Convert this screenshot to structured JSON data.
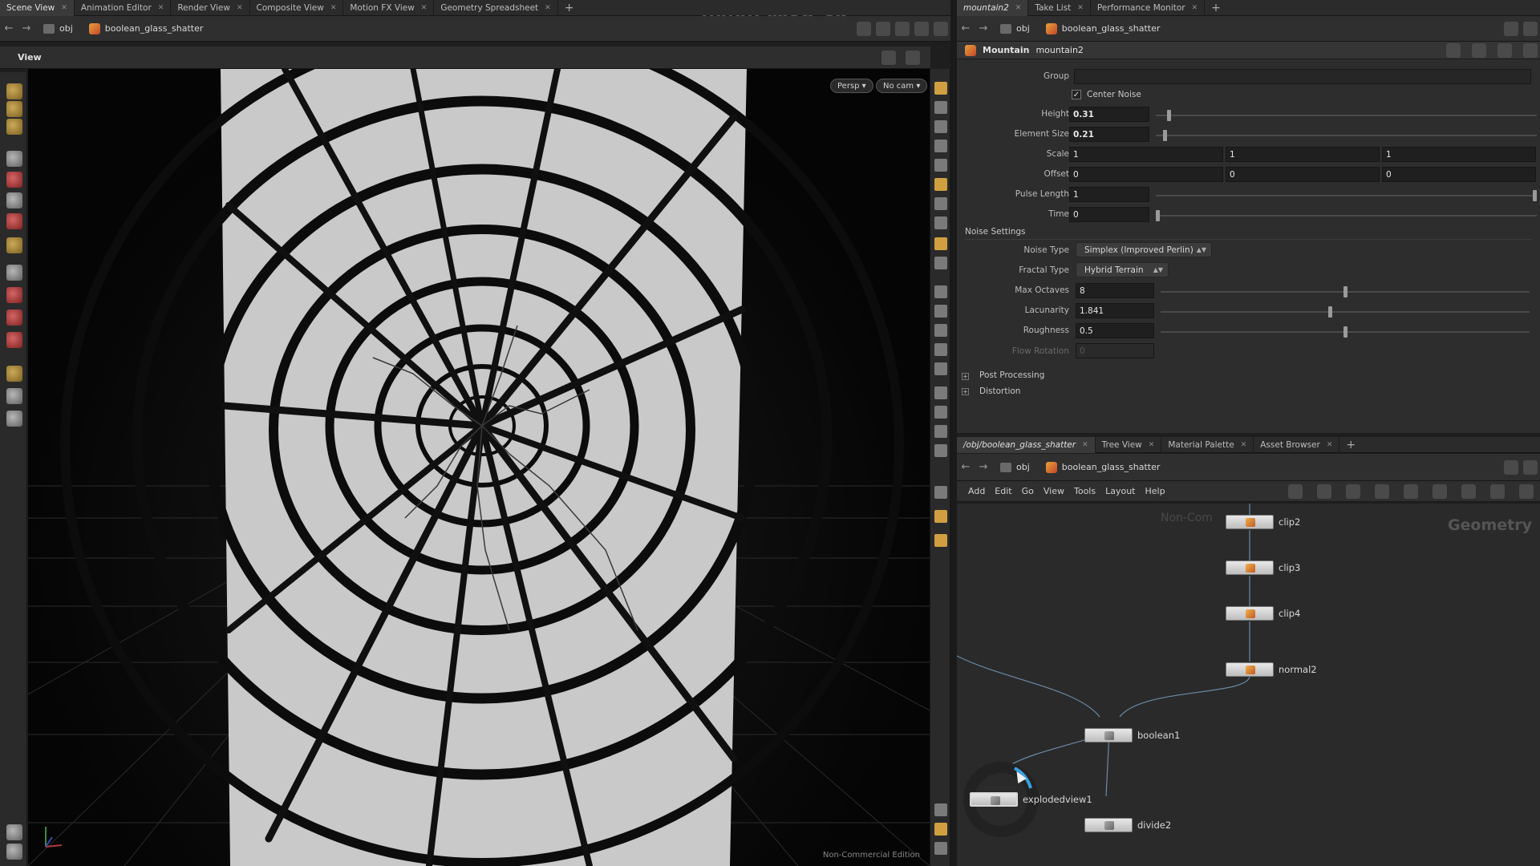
{
  "left_tabs": [
    {
      "label": "Scene View",
      "active": true
    },
    {
      "label": "Animation Editor"
    },
    {
      "label": "Render View"
    },
    {
      "label": "Composite View"
    },
    {
      "label": "Motion FX View"
    },
    {
      "label": "Geometry Spreadsheet"
    }
  ],
  "left_path": {
    "root": "obj",
    "node": "boolean_glass_shatter"
  },
  "viewport": {
    "title": "View",
    "persp_button": "Persp ▾",
    "cam_button": "No cam ▾",
    "edition_label": "Non-Commercial Edition"
  },
  "right_top_tabs": [
    {
      "label": "mountain2",
      "active": true
    },
    {
      "label": "Take List"
    },
    {
      "label": "Performance Monitor"
    }
  ],
  "right_top_path": {
    "root": "obj",
    "node": "boolean_glass_shatter"
  },
  "params": {
    "node_type": "Mountain",
    "node_name": "mountain2",
    "group_label": "Group",
    "center_noise_label": "Center Noise",
    "center_noise_checked": true,
    "height": {
      "label": "Height",
      "value": "0.31",
      "fraction": 0.03
    },
    "element_size": {
      "label": "Element Size",
      "value": "0.21",
      "fraction": 0.02
    },
    "scale": {
      "label": "Scale",
      "values": [
        "1",
        "1",
        "1"
      ]
    },
    "offset": {
      "label": "Offset",
      "values": [
        "0",
        "0",
        "0"
      ]
    },
    "pulse_length": {
      "label": "Pulse Length",
      "value": "1",
      "fraction": 1.0
    },
    "time": {
      "label": "Time",
      "value": "0",
      "fraction": 0.0
    },
    "noise_settings_label": "Noise Settings",
    "noise_type": {
      "label": "Noise Type",
      "value": "Simplex (Improved Perlin)"
    },
    "fractal_type": {
      "label": "Fractal Type",
      "value": "Hybrid Terrain"
    },
    "max_octaves": {
      "label": "Max Octaves",
      "value": "8",
      "fraction": 0.5
    },
    "lacunarity": {
      "label": "Lacunarity",
      "value": "1.841",
      "fraction": 0.46
    },
    "roughness": {
      "label": "Roughness",
      "value": "0.5",
      "fraction": 0.5
    },
    "flow_rotation": {
      "label": "Flow Rotation",
      "value": "0"
    },
    "post_processing_label": "Post Processing",
    "distortion_label": "Distortion"
  },
  "net_tabs": [
    {
      "label": "/obj/boolean_glass_shatter",
      "active": true
    },
    {
      "label": "Tree View"
    },
    {
      "label": "Material Palette"
    },
    {
      "label": "Asset Browser"
    }
  ],
  "net_path": {
    "root": "obj",
    "node": "boolean_glass_shatter"
  },
  "net_menu": [
    "Add",
    "Edit",
    "Go",
    "View",
    "Tools",
    "Layout",
    "Help"
  ],
  "net_context_label": "Geometry",
  "net_bg_text": "Non-Com",
  "nodes": [
    {
      "name": "clip2",
      "glyph": "color"
    },
    {
      "name": "clip3",
      "glyph": "color"
    },
    {
      "name": "clip4",
      "glyph": "color"
    },
    {
      "name": "normal2",
      "glyph": "color"
    },
    {
      "name": "boolean1",
      "glyph": "gray"
    },
    {
      "name": "explodedview1",
      "glyph": "gray"
    },
    {
      "name": "divide2",
      "glyph": "gray"
    }
  ],
  "watermark": "www.rrcg.cn"
}
